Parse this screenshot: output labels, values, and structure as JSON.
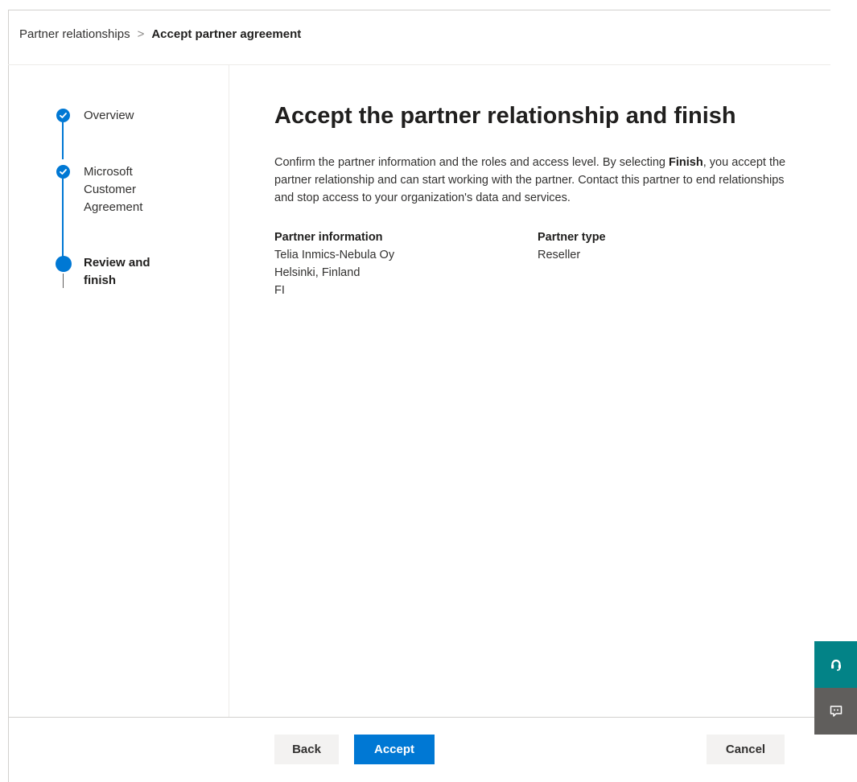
{
  "breadcrumb": {
    "parent": "Partner relationships",
    "separator": ">",
    "current": "Accept partner agreement"
  },
  "steps": [
    {
      "label": "Overview",
      "status": "completed"
    },
    {
      "label": "Microsoft Customer Agreement",
      "status": "completed"
    },
    {
      "label": "Review and finish",
      "status": "current"
    }
  ],
  "main": {
    "title": "Accept the partner relationship and finish",
    "description_before": "Confirm the partner information and the roles and access level. By selecting ",
    "description_bold": "Finish",
    "description_after": ", you accept the partner relationship and can start working with the partner. Contact this partner to end relationships and stop access to your organization's data and services.",
    "partner_info": {
      "heading": "Partner information",
      "name": "Telia Inmics-Nebula Oy",
      "location": "Helsinki, Finland",
      "country": "FI"
    },
    "partner_type": {
      "heading": "Partner type",
      "value": "Reseller"
    }
  },
  "footer": {
    "back_label": "Back",
    "accept_label": "Accept",
    "cancel_label": "Cancel"
  },
  "side_buttons": {
    "help_icon": "help-headset-icon",
    "feedback_icon": "feedback-chat-icon"
  },
  "colors": {
    "accent": "#0078d4",
    "help_button": "#038387",
    "feedback_button": "#605e5c"
  }
}
